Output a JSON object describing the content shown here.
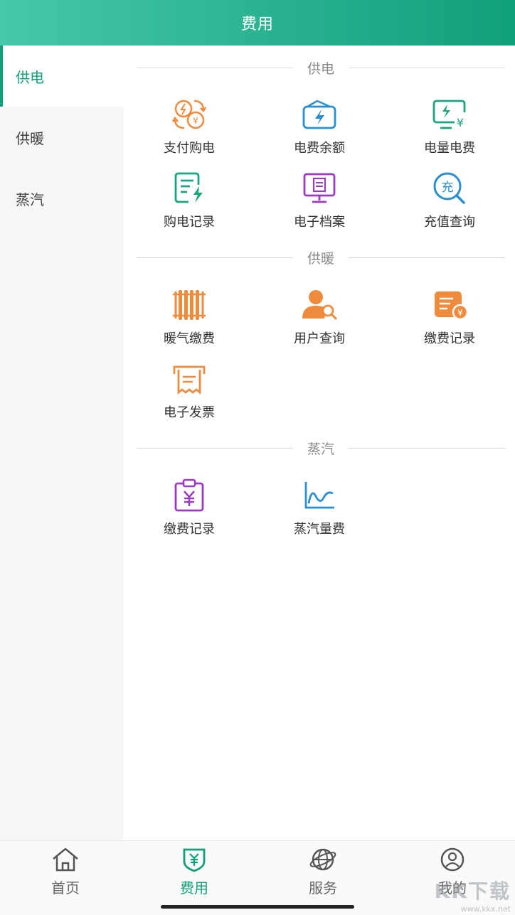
{
  "header": {
    "title": "费用"
  },
  "sidebar": {
    "items": [
      {
        "label": "供电",
        "active": true
      },
      {
        "label": "供暖",
        "active": false
      },
      {
        "label": "蒸汽",
        "active": false
      }
    ]
  },
  "sections": {
    "power": {
      "title": "供电",
      "items": [
        {
          "label": "支付购电",
          "icon": "payment-exchange-icon"
        },
        {
          "label": "电费余额",
          "icon": "wallet-icon"
        },
        {
          "label": "电量电费",
          "icon": "electric-fee-icon"
        },
        {
          "label": "购电记录",
          "icon": "purchase-record-icon"
        },
        {
          "label": "电子档案",
          "icon": "monitor-archive-icon"
        },
        {
          "label": "充值查询",
          "icon": "recharge-search-icon"
        }
      ]
    },
    "heating": {
      "title": "供暖",
      "items": [
        {
          "label": "暖气缴费",
          "icon": "radiator-icon"
        },
        {
          "label": "用户查询",
          "icon": "user-search-icon"
        },
        {
          "label": "缴费记录",
          "icon": "payment-record-icon"
        },
        {
          "label": "电子发票",
          "icon": "e-invoice-icon"
        }
      ]
    },
    "steam": {
      "title": "蒸汽",
      "items": [
        {
          "label": "缴费记录",
          "icon": "clipboard-yuan-icon"
        },
        {
          "label": "蒸汽量费",
          "icon": "line-chart-icon"
        }
      ]
    }
  },
  "tabbar": {
    "items": [
      {
        "label": "首页",
        "icon": "home-icon",
        "active": false
      },
      {
        "label": "费用",
        "icon": "yuan-shield-icon",
        "active": true
      },
      {
        "label": "服务",
        "icon": "globe-icon",
        "active": false
      },
      {
        "label": "我的",
        "icon": "user-circle-icon",
        "active": false
      }
    ]
  },
  "watermark": {
    "text": "KK下载",
    "url": "www.kkx.net"
  },
  "colors": {
    "brand": "#10a07a",
    "brand_light": "#47c7a9",
    "orange": "#f08a3c",
    "blue": "#2a8fd0",
    "purple": "#9b3bbf",
    "green": "#1aa57e"
  }
}
